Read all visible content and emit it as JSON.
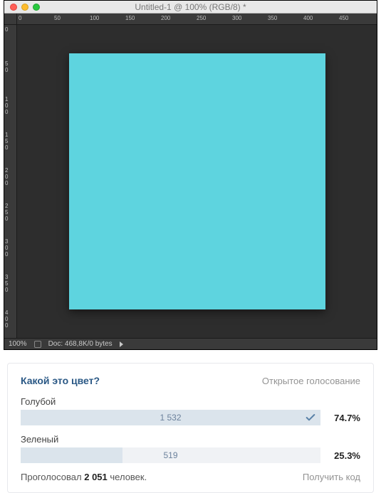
{
  "photoshop": {
    "title": "Untitled-1 @ 100% (RGB/8) *",
    "ruler_top_ticks": [
      "0",
      "50",
      "100",
      "150",
      "200",
      "250",
      "300",
      "350",
      "400",
      "450"
    ],
    "ruler_left_ticks": [
      "0",
      "5\n0",
      "1\n0\n0",
      "1\n5\n0",
      "2\n0\n0",
      "2\n5\n0",
      "3\n0\n0",
      "3\n5\n0",
      "4\n0\n0"
    ],
    "zoom": "100%",
    "docinfo": "Doc: 468,8K/0 bytes",
    "canvas_color": "#5ed4df"
  },
  "poll": {
    "question": "Какой это цвет?",
    "type_label": "Открытое голосование",
    "options": [
      {
        "label": "Голубой",
        "count": "1 532",
        "percent": "74.7%",
        "bar_width": "100%",
        "selected": true
      },
      {
        "label": "Зеленый",
        "count": "519",
        "percent": "25.3%",
        "bar_width": "34%",
        "selected": false
      }
    ],
    "total_prefix": "Проголосовал ",
    "total_number": "2 051",
    "total_suffix": " человек.",
    "getcode": "Получить код"
  }
}
